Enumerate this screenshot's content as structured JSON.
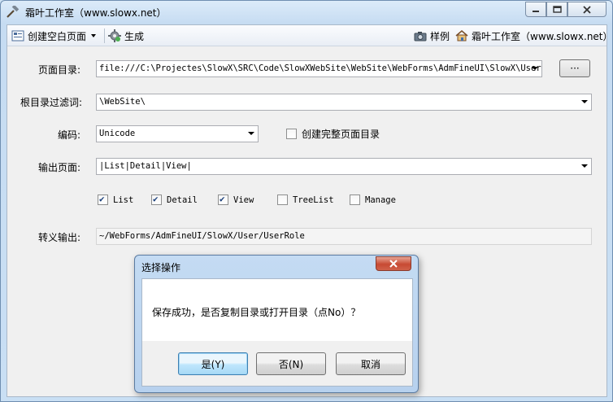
{
  "window": {
    "title": "霜叶工作室（www.slowx.net）"
  },
  "toolbar": {
    "create_blank_page": "创建空白页面",
    "generate": "生成",
    "sample": "样例",
    "studio_link": "霜叶工作室（www.slowx.net）"
  },
  "form": {
    "page_dir_label": "页面目录:",
    "page_dir_value": "file:///C:\\Projectes\\SlowX\\SRC\\Code\\SlowXWebSite\\WebSite\\WebForms\\AdmFineUI\\SlowX\\User\\U",
    "browse_button": "···",
    "root_filter_label": "根目录过滤词:",
    "root_filter_value": "\\WebSite\\",
    "encoding_label": "编码:",
    "encoding_value": "Unicode",
    "create_full_dir_label": "创建完整页面目录",
    "create_full_dir_checked": false,
    "output_page_label": "输出页面:",
    "output_page_value": "|List|Detail|View|",
    "checkboxes": [
      {
        "label": "List",
        "checked": true
      },
      {
        "label": "Detail",
        "checked": true
      },
      {
        "label": "View",
        "checked": true
      },
      {
        "label": "TreeList",
        "checked": false
      },
      {
        "label": "Manage",
        "checked": false
      }
    ],
    "escape_output_label": "转义输出:",
    "escape_output_value": "~/WebForms/AdmFineUI/SlowX/User/UserRole"
  },
  "dialog": {
    "title": "选择操作",
    "message": "保存成功，是否复制目录或打开目录（点No）？",
    "yes_button": "是(Y)",
    "no_button": "否(N)",
    "cancel_button": "取消"
  }
}
